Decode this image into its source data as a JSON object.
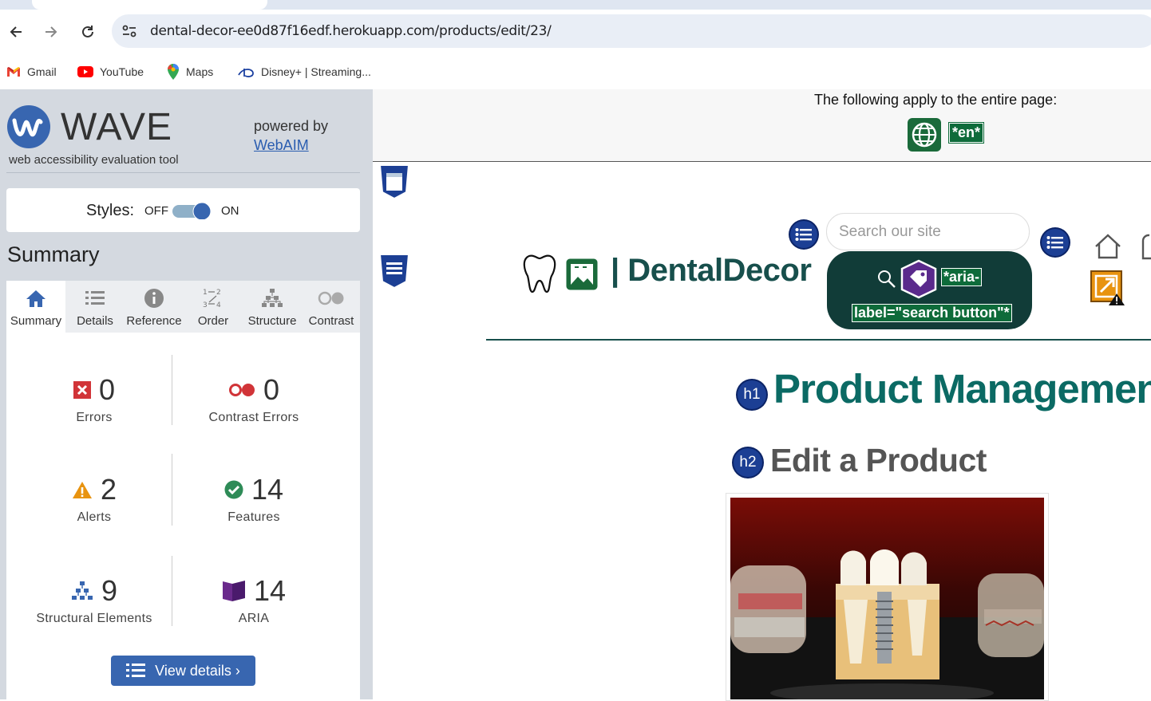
{
  "browser": {
    "url": "dental-decor-ee0d87f16edf.herokuapp.com/products/edit/23/",
    "bookmarks": [
      {
        "label": "Gmail",
        "icon": "gmail-icon"
      },
      {
        "label": "YouTube",
        "icon": "youtube-icon"
      },
      {
        "label": "Maps",
        "icon": "maps-icon"
      },
      {
        "label": "Disney+ | Streaming...",
        "icon": "disney-icon"
      }
    ]
  },
  "wave": {
    "brand": "WAVE",
    "tagline": "web accessibility evaluation tool",
    "powered_by": "powered by",
    "webaim": "WebAIM",
    "styles_label": "Styles:",
    "styles_off": "OFF",
    "styles_on": "ON",
    "summary_heading": "Summary",
    "tabs": [
      {
        "label": "Summary",
        "icon": "home-icon"
      },
      {
        "label": "Details",
        "icon": "list-icon"
      },
      {
        "label": "Reference",
        "icon": "info-icon"
      },
      {
        "label": "Order",
        "icon": "order-icon"
      },
      {
        "label": "Structure",
        "icon": "structure-icon"
      },
      {
        "label": "Contrast",
        "icon": "contrast-icon"
      }
    ],
    "stats": {
      "errors": {
        "count": "0",
        "label": "Errors"
      },
      "contrast_errors": {
        "count": "0",
        "label": "Contrast Errors"
      },
      "alerts": {
        "count": "2",
        "label": "Alerts"
      },
      "features": {
        "count": "14",
        "label": "Features"
      },
      "structural": {
        "count": "9",
        "label": "Structural Elements"
      },
      "aria": {
        "count": "14",
        "label": "ARIA"
      }
    },
    "view_details": "View details ›"
  },
  "page": {
    "apply_text": "The following apply to the entire page:",
    "lang_tag": "*en*",
    "brand": "| DentalDecor",
    "search_placeholder": "Search our site",
    "aria_label_1": "*aria-",
    "aria_label_2": "label=\"search button\"*",
    "h1_badge": "h1",
    "h1": "Product Management",
    "h2_badge": "h2",
    "h2": "Edit a Product"
  },
  "colors": {
    "wave_blue": "#3866b0",
    "brand_teal": "#174f4c",
    "aria_green": "#0e6b3a",
    "error_red": "#d13438"
  }
}
